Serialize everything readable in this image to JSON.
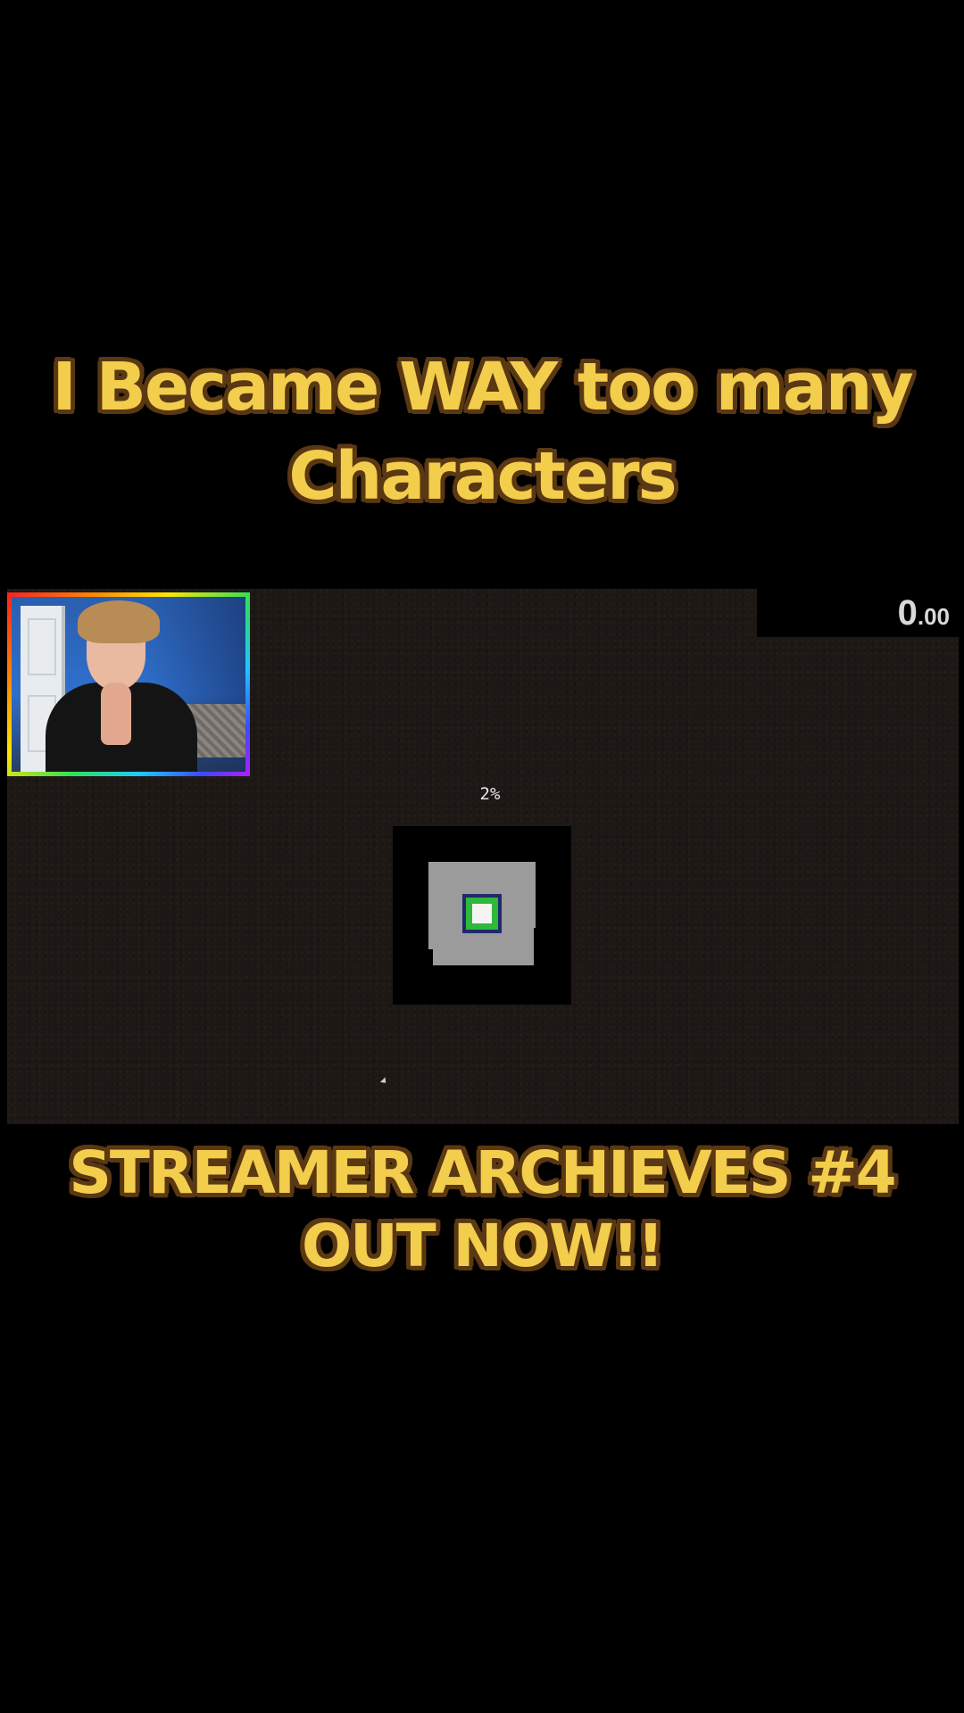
{
  "captions": {
    "title_line1": "I Became WAY too many",
    "title_line2": "Characters",
    "bottom_line1": "STREAMER ARCHIEVES #4",
    "bottom_line2": "OUT NOW!!"
  },
  "game": {
    "timer_main": "0",
    "timer_fraction": ".00",
    "progress_label": "2%"
  },
  "colors": {
    "caption_fill": "#f3cd4c",
    "caption_outline": "#5a3813",
    "game_background": "#1d1815",
    "minimap_room": "#9b9b9b",
    "player_outer": "#1f2a6b",
    "player_mid": "#2fb83a"
  },
  "icons": {
    "player": "player-marker-icon",
    "cursor": "mouse-cursor-icon"
  }
}
